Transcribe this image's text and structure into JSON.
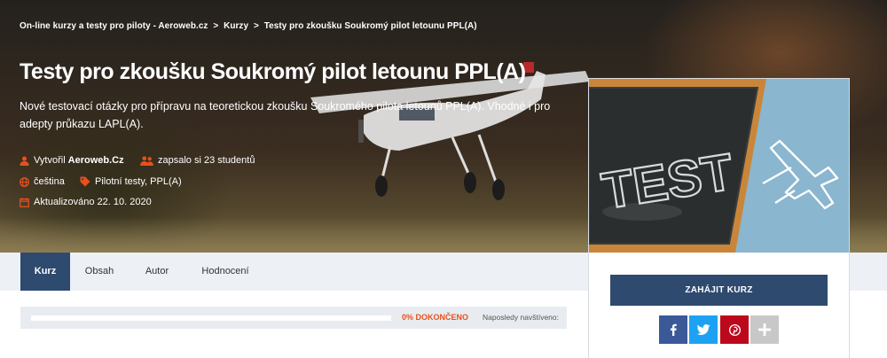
{
  "breadcrumb": {
    "items": [
      "On-line kurzy a testy pro piloty - Aeroweb.cz",
      "Kurzy",
      "Testy pro zkoušku Soukromý pilot letounu PPL(A)"
    ],
    "separator": ">"
  },
  "course": {
    "title": "Testy pro zkoušku Soukromý pilot letounu PPL(A)",
    "description": "Nové testovací otázky pro přípravu na teoretickou zkoušku Soukromého pilota letounů PPL(A). Vhodné i pro adepty průkazu LAPL(A).",
    "created_by_prefix": "Vytvořil",
    "created_by_name": "Aeroweb.Cz",
    "enrolled": "zapsalo si 23 studentů",
    "language": "čeština",
    "categories": "Pilotní testy, PPL(A)",
    "updated": "Aktualizováno 22. 10. 2020"
  },
  "tabs": [
    {
      "label": "Kurz",
      "active": true
    },
    {
      "label": "Obsah",
      "active": false
    },
    {
      "label": "Autor",
      "active": false
    },
    {
      "label": "Hodnocení",
      "active": false
    }
  ],
  "progress": {
    "percent": 0,
    "label": "0% DOKONČENO",
    "last_visited": "Naposledy navštíveno:"
  },
  "sidebar": {
    "thumbnail_text": "TEST",
    "start_button": "ZAHÁJIT KURZ",
    "share": [
      {
        "icon": "facebook-icon",
        "color": "#3b5998"
      },
      {
        "icon": "twitter-icon",
        "color": "#1da1f2"
      },
      {
        "icon": "pinterest-icon",
        "color": "#bd081c"
      },
      {
        "icon": "plus-icon",
        "color": "#c8c8c8"
      }
    ]
  },
  "colors": {
    "accent": "#e8501e",
    "navy": "#2e4a6f",
    "tabs_bg": "#edf0f4"
  }
}
